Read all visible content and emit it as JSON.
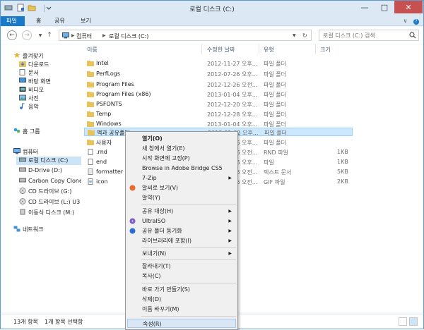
{
  "window": {
    "title": "로컬 디스크 (C:)"
  },
  "ribbon": {
    "tabs": [
      {
        "label": "파일"
      },
      {
        "label": "홈"
      },
      {
        "label": "공유"
      },
      {
        "label": "보기"
      }
    ]
  },
  "address": {
    "path": [
      "컴퓨터",
      "로컬 디스크 (C:)"
    ]
  },
  "search": {
    "placeholder": "로컬 디스크 (C:) 검색"
  },
  "nav": {
    "favorites": "즐겨찾기",
    "favorites_items": [
      "다운로드",
      "문서",
      "바탕 화면",
      "비디오",
      "사진",
      "음악"
    ],
    "homegroup": "홈 그룹",
    "computer": "컴퓨터",
    "drives": [
      "로컬 디스크 (C:)",
      "D-Drive (D:)",
      "Carbon Copy Clone",
      "CD 드라이브 (G:)",
      "CD 드라이브 (L:) U3",
      "이동식 디스크 (M:)"
    ],
    "network": "네트워크"
  },
  "columns": {
    "name": "이름",
    "modified": "수정한 날짜",
    "type": "유형",
    "size": "크기"
  },
  "files": [
    {
      "name": "Intel",
      "date": "2012-11-27 오후...",
      "type": "파일 폴더",
      "size": ""
    },
    {
      "name": "PerfLogs",
      "date": "2012-07-26 오후...",
      "type": "파일 폴더",
      "size": ""
    },
    {
      "name": "Program Files",
      "date": "2012-12-26 오전...",
      "type": "파일 폴더",
      "size": ""
    },
    {
      "name": "Program Files (x86)",
      "date": "2013-01-04 오후...",
      "type": "파일 폴더",
      "size": ""
    },
    {
      "name": "PSFONTS",
      "date": "2012-12-20 오후...",
      "type": "파일 폴더",
      "size": ""
    },
    {
      "name": "Temp",
      "date": "2012-12-28 오후...",
      "type": "파일 폴더",
      "size": ""
    },
    {
      "name": "Windows",
      "date": "2013-01-04 오후...",
      "type": "파일 폴더",
      "size": ""
    },
    {
      "name": "맥과 공유폴더",
      "date": "2013-01-02 오후...",
      "type": "파일 폴더",
      "size": ""
    },
    {
      "name": "사용자",
      "date": "2012-12-26 오후...",
      "type": "파일 폴더",
      "size": ""
    },
    {
      "name": ".rnd",
      "date": "2012-12-26 오전...",
      "type": "RND 파일",
      "size": "1KB"
    },
    {
      "name": "end",
      "date": "2012-12-26 오후...",
      "type": "파일",
      "size": "1KB"
    },
    {
      "name": "formatter",
      "date": "2012-12-26 오전...",
      "type": "텍스트 문서",
      "size": "5KB"
    },
    {
      "name": "icon",
      "date": "2012-12-26 오전...",
      "type": "GIF 파일",
      "size": "2KB"
    }
  ],
  "context_menu": {
    "items": [
      {
        "label": "열기(O)"
      },
      {
        "label": "새 창에서 열기(E)"
      },
      {
        "label": "시작 화면에 고정(P)"
      },
      {
        "label": "Browse in Adobe Bridge CS5"
      },
      {
        "label": "7-Zip"
      },
      {
        "label": "알씨로 보기(V)"
      },
      {
        "label": "알약(Y)"
      },
      {
        "label": "공유 대상(H)"
      },
      {
        "label": "UltraISO"
      },
      {
        "label": "공유 폴더 동기화"
      },
      {
        "label": "라이브러리에 포함(I)"
      },
      {
        "label": "보내기(N)"
      },
      {
        "label": "잘라내기(T)"
      },
      {
        "label": "복사(C)"
      },
      {
        "label": "바로 가기 만들기(S)"
      },
      {
        "label": "삭제(D)"
      },
      {
        "label": "이름 바꾸기(M)"
      },
      {
        "label": "속성(R)"
      }
    ]
  },
  "status": {
    "item_count": "13개 항목",
    "selected": "1개 항목 선택함"
  },
  "colors": {
    "accent": "#1979ca",
    "folder": "#e8c25a",
    "selection": "#cce8ff"
  }
}
